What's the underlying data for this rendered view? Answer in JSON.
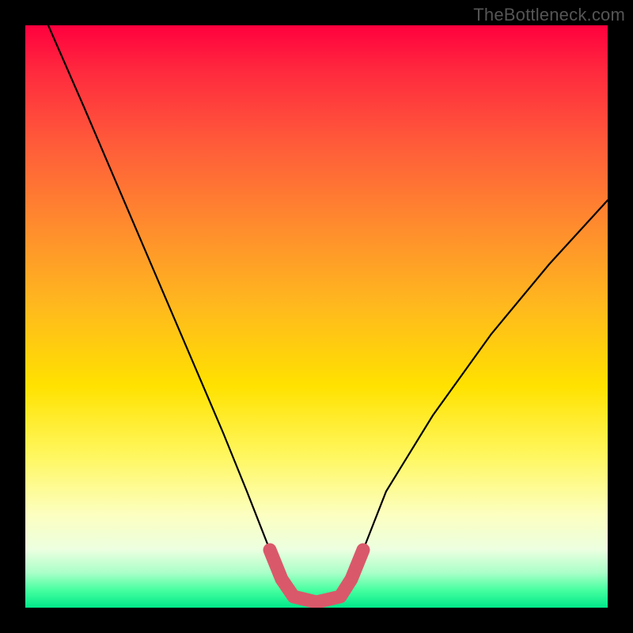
{
  "watermark": "TheBottleneck.com",
  "chart_data": {
    "type": "line",
    "title": "",
    "xlabel": "",
    "ylabel": "",
    "xlim": [
      0,
      100
    ],
    "ylim": [
      0,
      100
    ],
    "series": [
      {
        "name": "black-curve",
        "x": [
          4,
          10,
          16,
          22,
          28,
          34,
          38,
          42,
          44,
          46,
          50,
          54,
          56,
          58,
          62,
          70,
          80,
          90,
          100
        ],
        "y": [
          100,
          86,
          72,
          58,
          44,
          30,
          20,
          10,
          5,
          2,
          1,
          2,
          5,
          10,
          20,
          33,
          47,
          59,
          70
        ],
        "stroke": "#000000",
        "stroke_width": 2
      },
      {
        "name": "red-trough-highlight",
        "x": [
          42,
          44,
          46,
          50,
          54,
          56,
          58
        ],
        "y": [
          10,
          5,
          2,
          1,
          2,
          5,
          10
        ],
        "stroke": "#d9596a",
        "stroke_width": 14
      }
    ],
    "background_gradient": {
      "top": "#ff003e",
      "mid": "#ffe200",
      "bottom": "#00e88a"
    }
  }
}
